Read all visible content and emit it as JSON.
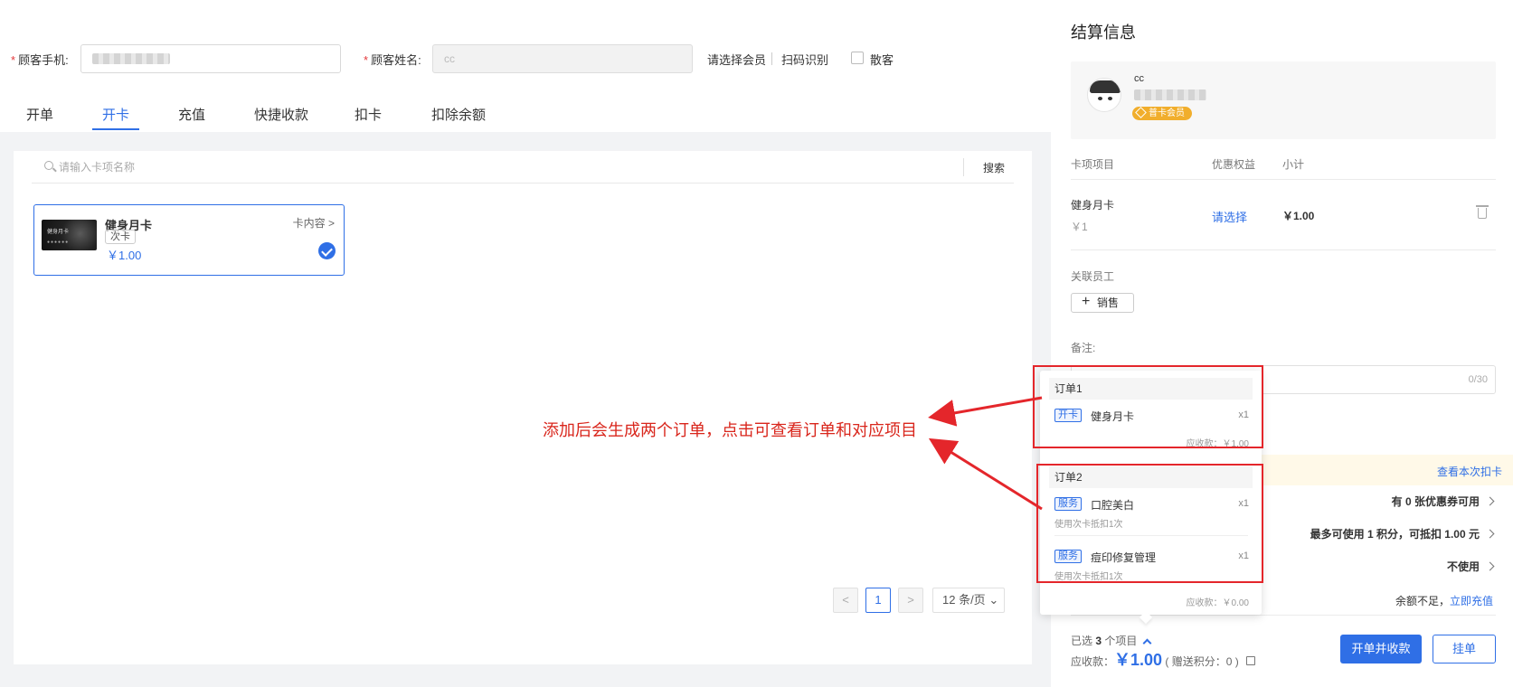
{
  "form": {
    "phone_label": "顾客手机:",
    "name_label": "顾客姓名:",
    "name_value": "cc",
    "select_member": "请选择会员",
    "scan": "扫码识别",
    "walk_in": "散客"
  },
  "tabs": [
    "开单",
    "开卡",
    "充值",
    "快捷收款",
    "扣卡",
    "扣除余额"
  ],
  "search": {
    "placeholder": "请输入卡项名称",
    "button": "搜索"
  },
  "card": {
    "thumb_title": "健身月卡",
    "thumb_dots": "●●●●●●",
    "name": "健身月卡",
    "tag": "次卡",
    "price": "￥1.00",
    "content_link": "卡内容"
  },
  "pagination": {
    "prev": "<",
    "page": "1",
    "next": ">",
    "size": "12 条/页"
  },
  "annotation": "添加后会生成两个订单，点击可查看订单和对应项目",
  "settlement": {
    "title": "结算信息",
    "member_name": "cc",
    "member_badge": "普卡会员",
    "columns": [
      "卡项项目",
      "优惠权益",
      "小计"
    ],
    "item": {
      "name": "健身月卡",
      "sub": "￥1",
      "select": "请选择",
      "total": "￥1.00"
    },
    "staff_label": "关联员工",
    "staff_button": "销售",
    "remark_label": "备注:",
    "remark_count": "0/30",
    "deduct_link": "查看本次扣卡",
    "coupon_text": "有 0 张优惠券可用",
    "points_text": "最多可使用 1 积分，可抵扣 1.00 元",
    "other_text": "不使用",
    "balance_text": "余额不足，",
    "recharge_link": "立即充值",
    "selected_prefix": "已选",
    "selected_count": "3",
    "selected_suffix": "个项目",
    "receivable_label": "应收款：",
    "receivable_amount": "￥1.00",
    "points_gift": "( 赠送积分：0 )",
    "btn_checkout": "开单并收款",
    "btn_hold": "挂单"
  },
  "popover": {
    "order1": {
      "title": "订单1",
      "items": [
        {
          "tag": "开卡",
          "name": "健身月卡",
          "qty": "x1"
        }
      ],
      "total": "应收款：￥1.00"
    },
    "order2": {
      "title": "订单2",
      "items": [
        {
          "tag": "服务",
          "name": "口腔美白",
          "qty": "x1",
          "sub": "使用次卡抵扣1次"
        },
        {
          "tag": "服务",
          "name": "痘印修复管理",
          "qty": "x1",
          "sub": "使用次卡抵扣1次"
        }
      ],
      "total": "应收款：￥0.00"
    }
  },
  "colors": {
    "accent": "#2f6fe6",
    "annotation_red": "#e4262b",
    "badge": "#f1ae2c"
  }
}
